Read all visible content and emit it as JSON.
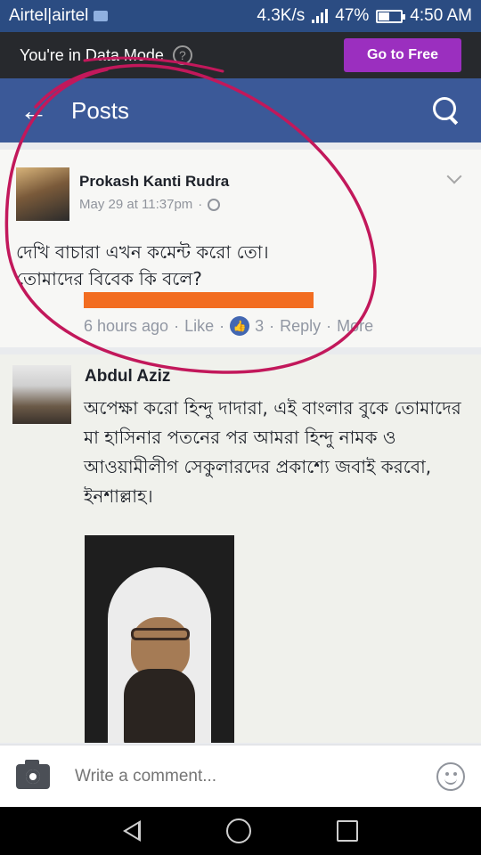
{
  "status_bar": {
    "carrier": "Airtel|airtel",
    "speed": "4.3K/s",
    "battery": "47%",
    "battery_level": 0.47,
    "time": "4:50 AM"
  },
  "data_bar": {
    "message": "You're in Data Mode",
    "help_glyph": "?",
    "button_label": "Go to Free"
  },
  "nav": {
    "back_glyph": "←",
    "title": "Posts"
  },
  "post": {
    "author": "Prokash Kanti Rudra",
    "date": "May 29 at 11:37pm",
    "separator": "·",
    "text_line1": "দেখি বাচারা এখন কমেন্ট করো তো।",
    "text_line2": "তোমাদের বিবেক কি বলে?",
    "actions": {
      "time": "6 hours ago",
      "like": "Like",
      "like_count": "3",
      "reply": "Reply",
      "more": "More",
      "dot": "·"
    },
    "accent_color": "#f26d21"
  },
  "comment": {
    "author": "Abdul Aziz",
    "text": "অপেক্ষা করো হিন্দু দাদারা, এই বাংলার বুকে তোমাদের মা হাসিনার পতনের পর আমরা হিন্দু নামক ও আওয়ামীলীগ সেকুলারদের প্রকাশ্যে জবাই করবো, ইনশাল্লাহ।"
  },
  "comment_bar": {
    "placeholder": "Write a comment..."
  },
  "colors": {
    "facebook_blue": "#3b5998",
    "status_bar": "#2b4c82",
    "data_bar": "#27292d",
    "go_free_button": "#9b2fbf",
    "annotation": "#c2185b"
  }
}
